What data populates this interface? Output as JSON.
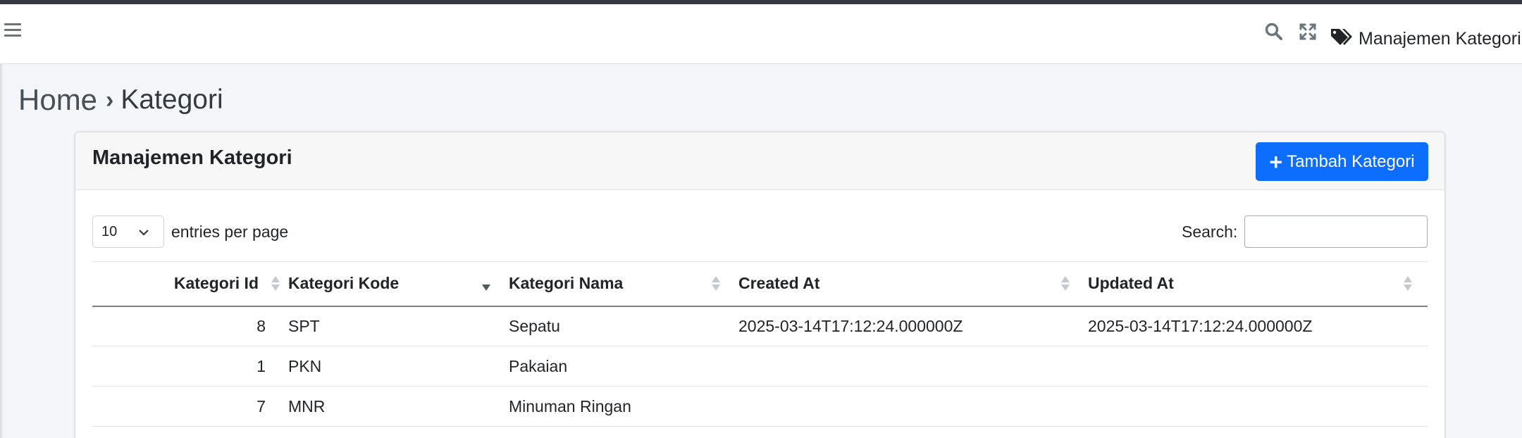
{
  "navbar": {
    "title": "Manajemen Kategori",
    "icons": [
      "hamburger-icon",
      "search-icon",
      "expand-icon",
      "tags-icon"
    ]
  },
  "breadcrumb": {
    "home": "Home",
    "separator": "›",
    "current": "Kategori"
  },
  "card": {
    "title": "Manajemen Kategori",
    "add_button": "Tambah Kategori",
    "entries_value": "10",
    "entries_label": "entries per page",
    "search_label": "Search:",
    "search_value": ""
  },
  "table": {
    "columns": [
      "Kategori Id",
      "Kategori Kode",
      "Kategori Nama",
      "Created At",
      "Updated At"
    ],
    "sorted_column": "Kategori Kode",
    "sort_direction": "descending",
    "rows": [
      {
        "id": "8",
        "kode": "SPT",
        "nama": "Sepatu",
        "created_at": "2025-03-14T17:12:24.000000Z",
        "updated_at": "2025-03-14T17:12:24.000000Z"
      },
      {
        "id": "1",
        "kode": "PKN",
        "nama": "Pakaian",
        "created_at": "",
        "updated_at": ""
      },
      {
        "id": "7",
        "kode": "MNR",
        "nama": "Minuman Ringan",
        "created_at": "",
        "updated_at": ""
      }
    ]
  },
  "colors": {
    "primary": "#0d6efd",
    "background": "#f4f6f9",
    "topbar": "#343a40"
  }
}
